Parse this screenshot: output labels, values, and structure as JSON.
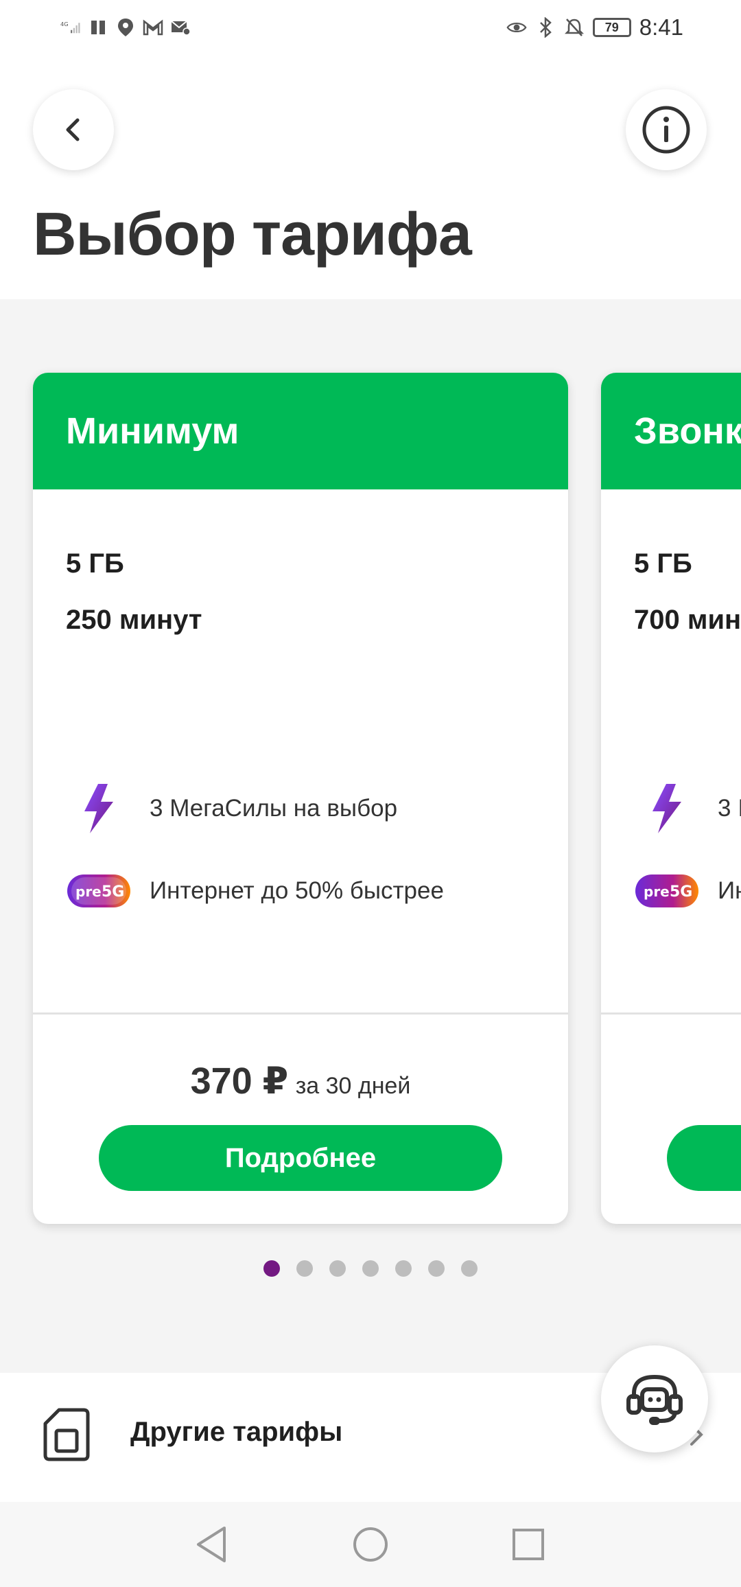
{
  "status_bar": {
    "network_label": "4G",
    "time": "8:41",
    "battery": "79"
  },
  "header": {
    "title": "Выбор тарифа",
    "back_icon": "chevron-left-icon",
    "info_icon": "info-icon"
  },
  "tariffs": [
    {
      "name": "Минимум",
      "data": "5 ГБ",
      "minutes": "250 минут",
      "features": [
        {
          "icon": "lightning-icon",
          "text": "3 МегаСилы на выбор"
        },
        {
          "icon": "pre5g-badge-icon",
          "text": "Интернет до 50% быстрее"
        }
      ],
      "price": "370 ₽",
      "period": "за 30 дней",
      "button": "Подробнее"
    },
    {
      "name": "Звонк",
      "data": "5 ГБ",
      "minutes": "700 мин",
      "features": [
        {
          "icon": "lightning-icon",
          "text": "3 I"
        },
        {
          "icon": "pre5g-badge-icon",
          "text": "Ин"
        }
      ],
      "price": "",
      "period": "",
      "button": ""
    }
  ],
  "pagination": {
    "total": 7,
    "active": 0
  },
  "other_tariffs": {
    "label": "Другие тарифы",
    "icon": "sim-card-icon"
  },
  "support": {
    "icon": "support-headset-icon"
  },
  "colors": {
    "brand_green": "#00b956",
    "brand_purple": "#731982",
    "text_dark": "#333333",
    "background_grey": "#f4f4f4"
  },
  "nav": {
    "back": "nav-back-icon",
    "home": "nav-home-icon",
    "recent": "nav-recent-icon"
  }
}
